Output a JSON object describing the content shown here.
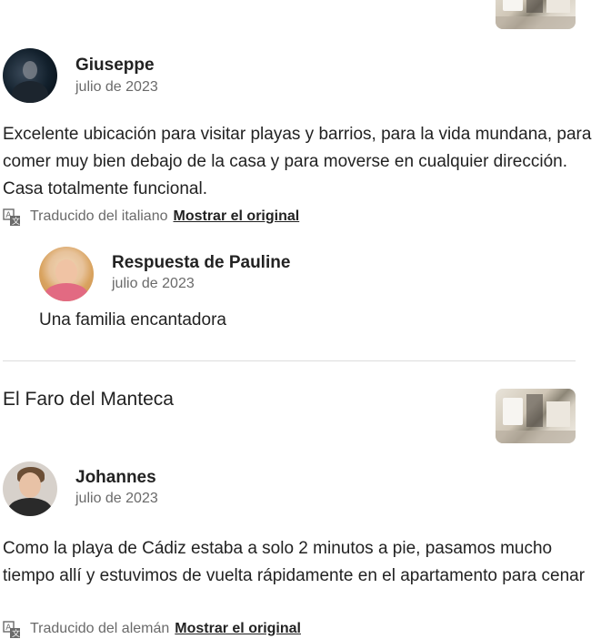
{
  "reviews": [
    {
      "reviewer": {
        "name": "Giuseppe",
        "date": "julio de 2023"
      },
      "text": "Excelente ubicación para visitar playas y barrios, para la vida mundana, para comer muy bien debajo de la casa y para moverse en cualquier dirección. Casa totalmente funcional.",
      "translation": {
        "note": "Traducido del italiano",
        "link": "Mostrar el original"
      },
      "response": {
        "title": "Respuesta de Pauline",
        "date": "julio de 2023",
        "text": "Una familia encantadora"
      }
    },
    {
      "listing_title": "El Faro del Manteca",
      "reviewer": {
        "name": "Johannes",
        "date": "julio de 2023"
      },
      "text": "Como la playa de Cádiz estaba a solo 2 minutos a pie, pasamos mucho tiempo allí y estuvimos de vuelta rápidamente en el apartamento para cenar",
      "translation": {
        "note": "Traducido del alemán",
        "link": "Mostrar el original"
      }
    }
  ],
  "icons": {
    "translate": "translate-icon",
    "listing_photo": "listing-thumbnail"
  }
}
